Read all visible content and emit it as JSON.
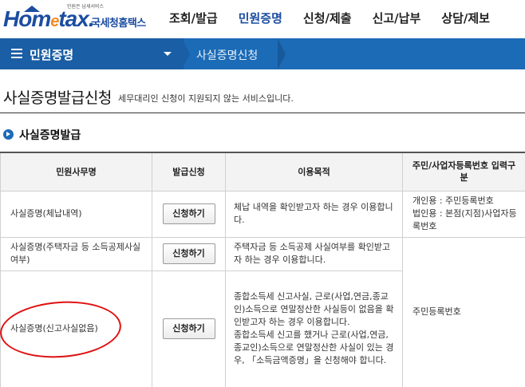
{
  "header": {
    "logo_small": "민원은 납세서비스",
    "logo_main_a": "Hom",
    "logo_main_e": "e",
    "logo_main_b": "tax.",
    "logo_kr": "국세청홈택스",
    "menu": [
      {
        "label": "조회/발급",
        "active": false
      },
      {
        "label": "민원증명",
        "active": true
      },
      {
        "label": "신청/제출",
        "active": false
      },
      {
        "label": "신고/납부",
        "active": false
      },
      {
        "label": "상담/제보",
        "active": false
      }
    ]
  },
  "navbar": {
    "title": "민원증명",
    "breadcrumb": "사실증명신청"
  },
  "page": {
    "title": "사실증명발급신청",
    "desc": "세무대리인 신청이 지원되지 않는 서비스입니다.",
    "section_title": "사실증명발급"
  },
  "table": {
    "headers": [
      "민원사무명",
      "발급신청",
      "이용목적",
      "주민/사업자등록번호 입력구분"
    ],
    "button_label": "신청하기",
    "rows": [
      {
        "name": "사실증명(체납내역)",
        "purpose": "체납 내역을 확인받고자 하는 경우 이용합니다.",
        "idtype": "개인용 : 주민등록번호\n법인용 : 본점(지점)사업자등록번호"
      },
      {
        "name": "사실증명(주택자금 등 소득공제사실여부)",
        "purpose": "주택자금 등 소득공제 사실여부를 확인받고자 하는 경우 이용합니다.",
        "idtype": "주민등록번호"
      },
      {
        "name": "사실증명(신고사실없음)",
        "purpose": "종합소득세 신고사실, 근로(사업,연금,종교인)소득으로 연말정산한 사실등이 없음을 확인받고자 하는 경우 이용합니다.\n종합소득세 신고를 했거나 근로(사업,연금,종교인)소득으로 연말정산한 사실이 있는 경우, 「소득금액증명」을 신청해야 합니다.",
        "idtype": ""
      }
    ]
  }
}
